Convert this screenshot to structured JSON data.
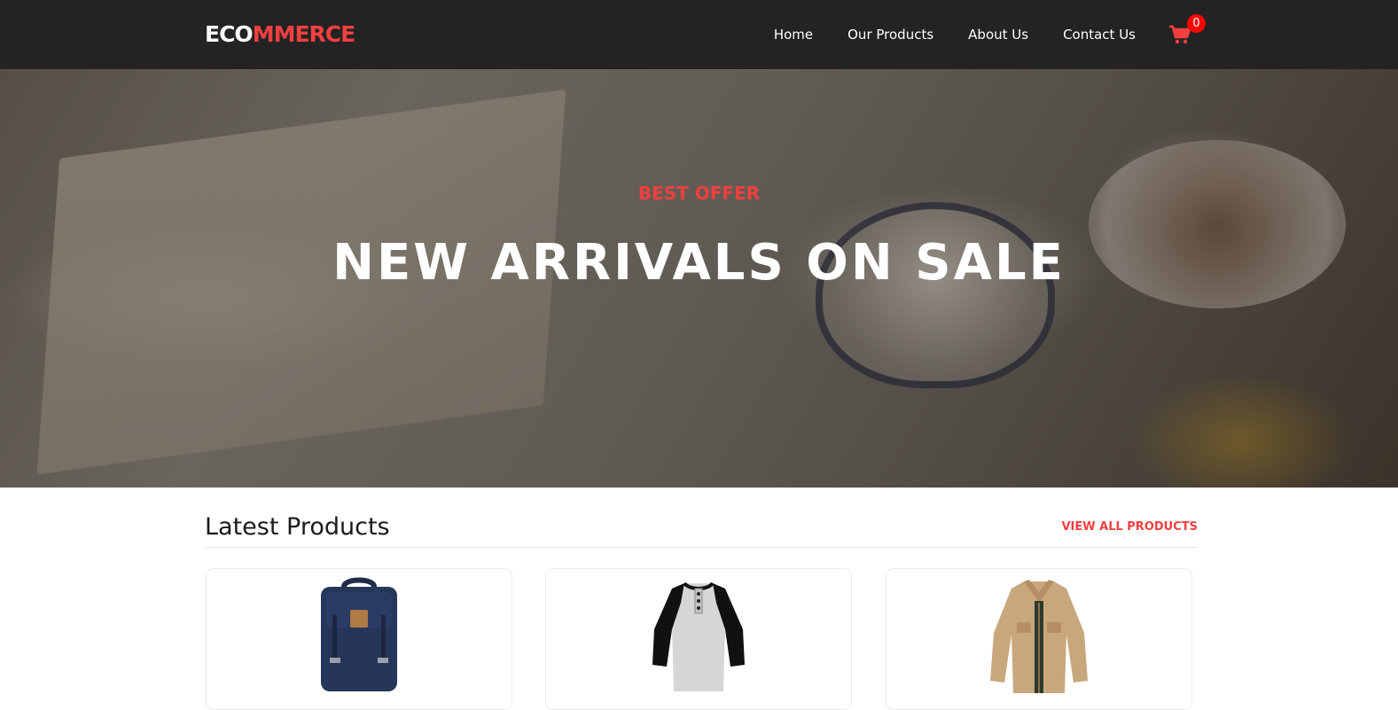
{
  "brand": {
    "part1": "ECO",
    "part2": "MMERCE"
  },
  "nav": {
    "links": [
      "Home",
      "Our Products",
      "About Us",
      "Contact Us"
    ],
    "cart_count": "0",
    "cart_icon": "shopping-cart-icon"
  },
  "hero": {
    "tag": "BEST OFFER",
    "title": "NEW ARRIVALS ON SALE"
  },
  "latest": {
    "title": "Latest Products",
    "view_all": "VIEW ALL PRODUCTS",
    "products": [
      {
        "image": "backpack"
      },
      {
        "image": "raglan-henley-shirt"
      },
      {
        "image": "khaki-jacket"
      }
    ]
  },
  "colors": {
    "navbar_bg": "#232323",
    "accent": "#f33f3f",
    "badge": "#f70404"
  }
}
